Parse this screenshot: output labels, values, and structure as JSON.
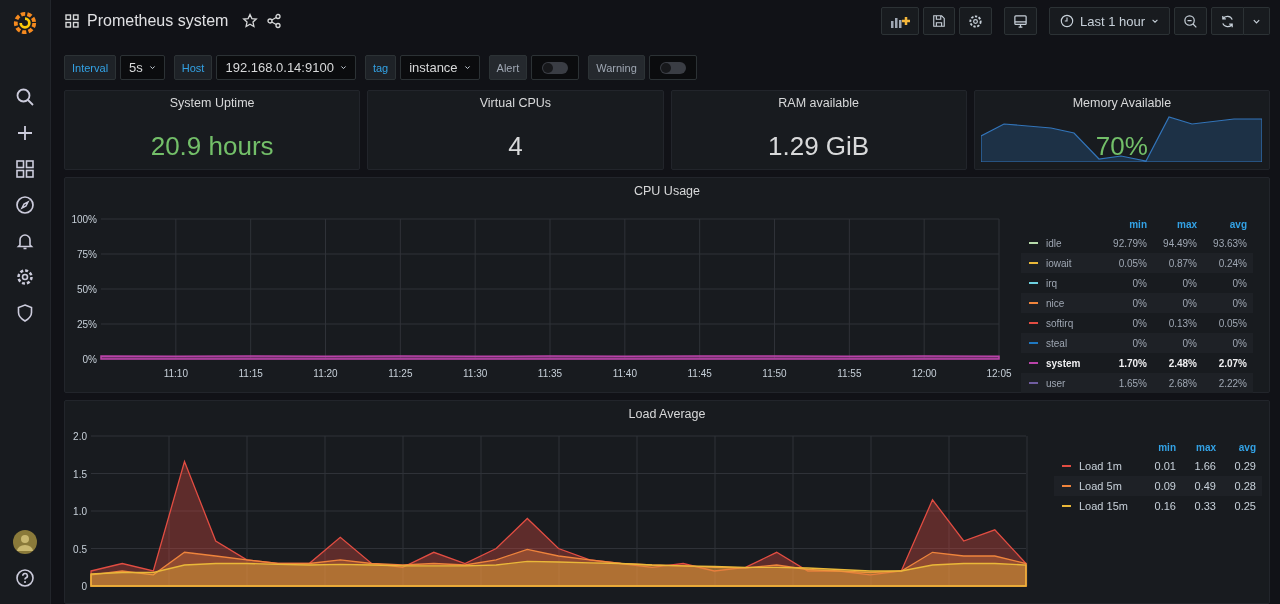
{
  "dashboard": {
    "title": "Prometheus system",
    "starred": false
  },
  "toolbar": {
    "time_range": "Last 1 hour"
  },
  "variables": [
    {
      "kind": "select",
      "label": "Interval",
      "value": "5s"
    },
    {
      "kind": "select",
      "label": "Host",
      "value": "192.168.0.14:9100"
    },
    {
      "kind": "select",
      "label": "tag",
      "value": "instance"
    },
    {
      "kind": "toggle",
      "label": "Alert",
      "on": false
    },
    {
      "kind": "toggle",
      "label": "Warning",
      "on": false
    }
  ],
  "stats": [
    {
      "title": "System Uptime",
      "value": "20.9 hours",
      "color": "#73bf69",
      "sparkline": false
    },
    {
      "title": "Virtual CPUs",
      "value": "4",
      "color": "#d8d9da",
      "sparkline": false
    },
    {
      "title": "RAM available",
      "value": "1.29 GiB",
      "color": "#d8d9da",
      "sparkline": false
    },
    {
      "title": "Memory Available",
      "value": "70%",
      "color": "#73bf69",
      "sparkline": true
    }
  ],
  "cpu_panel": {
    "title": "CPU Usage",
    "legend": {
      "columns": [
        "min",
        "max",
        "avg"
      ],
      "rows": [
        {
          "kind": "unplotted",
          "name": "idle",
          "color": "#b7dbab",
          "highlighted": false,
          "values": [
            "92.79%",
            "94.49%",
            "93.63%"
          ]
        },
        {
          "kind": "unplotted",
          "name": "iowait",
          "color": "#eab839",
          "highlighted": false,
          "values": [
            "0.05%",
            "0.87%",
            "0.24%"
          ]
        },
        {
          "kind": "unplotted",
          "name": "irq",
          "color": "#6ed0e0",
          "highlighted": false,
          "values": [
            "0%",
            "0%",
            "0%"
          ]
        },
        {
          "kind": "unplotted",
          "name": "nice",
          "color": "#ef843c",
          "highlighted": false,
          "values": [
            "0%",
            "0%",
            "0%"
          ]
        },
        {
          "kind": "unplotted",
          "name": "softirq",
          "color": "#e24d42",
          "highlighted": false,
          "values": [
            "0%",
            "0.13%",
            "0.05%"
          ]
        },
        {
          "kind": "unplotted",
          "name": "steal",
          "color": "#1f78c1",
          "highlighted": false,
          "values": [
            "0%",
            "0%",
            "0%"
          ]
        },
        {
          "kind": "plotted",
          "highlighted": true,
          "values": [
            "1.70%",
            "2.48%",
            "2.07%"
          ]
        },
        {
          "kind": "unplotted",
          "name": "user",
          "color": "#705da0",
          "highlighted": false,
          "values": [
            "1.65%",
            "2.68%",
            "2.22%"
          ]
        }
      ]
    },
    "chart_data": {
      "type": "area",
      "grid": true,
      "legend": "right",
      "categories": [
        null,
        "11:10",
        "11:15",
        "11:20",
        "11:25",
        "11:30",
        "11:35",
        "11:40",
        "11:45",
        "11:50",
        "11:55",
        "12:00",
        "12:05"
      ],
      "ylim": [
        0,
        100
      ],
      "yticks": [
        {
          "value": 0,
          "label": "0%"
        },
        {
          "value": 25,
          "label": "25%"
        },
        {
          "value": 50,
          "label": "50%"
        },
        {
          "value": 75,
          "label": "75%"
        },
        {
          "value": 100,
          "label": "100%"
        }
      ],
      "series": [
        {
          "name": "system",
          "color": "#ba43a9",
          "values": [
            2.1,
            2.0,
            2.2,
            2.0,
            2.1,
            2.0,
            2.1,
            2.0,
            2.1,
            2.2,
            2.0,
            2.1,
            2.0
          ]
        }
      ]
    }
  },
  "load_panel": {
    "title": "Load Average",
    "legend": {
      "columns": [
        "min",
        "max",
        "avg"
      ],
      "rows": [
        {
          "kind": "plotted",
          "highlighted": false,
          "values": [
            "0.01",
            "1.66",
            "0.29"
          ]
        },
        {
          "kind": "plotted",
          "highlighted": false,
          "values": [
            "0.09",
            "0.49",
            "0.28"
          ]
        },
        {
          "kind": "plotted",
          "highlighted": false,
          "values": [
            "0.16",
            "0.33",
            "0.25"
          ]
        }
      ]
    },
    "chart_data": {
      "type": "area",
      "grid": true,
      "legend": "right",
      "categories": [
        null,
        null,
        null,
        null,
        null,
        null,
        null,
        null,
        null,
        null,
        null,
        null,
        null,
        null,
        null,
        null,
        null,
        null,
        null,
        null,
        null,
        null,
        null,
        null,
        null,
        null,
        null,
        null,
        null,
        null,
        null
      ],
      "ylim": [
        0,
        2
      ],
      "yticks": [
        {
          "value": 0,
          "label": "0"
        },
        {
          "value": 0.5,
          "label": "0.5"
        },
        {
          "value": 1,
          "label": "1.0"
        },
        {
          "value": 1.5,
          "label": "1.5"
        },
        {
          "value": 2,
          "label": "2.0"
        }
      ],
      "series": [
        {
          "name": "Load 1m",
          "color": "#e24d42",
          "values": [
            0.2,
            0.3,
            0.2,
            1.66,
            0.6,
            0.35,
            0.3,
            0.3,
            0.65,
            0.3,
            0.25,
            0.45,
            0.3,
            0.5,
            0.9,
            0.5,
            0.35,
            0.3,
            0.25,
            0.3,
            0.2,
            0.25,
            0.45,
            0.2,
            0.2,
            0.15,
            0.2,
            1.15,
            0.6,
            0.75,
            0.3
          ]
        },
        {
          "name": "Load 5m",
          "color": "#ef843c",
          "values": [
            0.15,
            0.2,
            0.15,
            0.45,
            0.4,
            0.35,
            0.3,
            0.3,
            0.35,
            0.3,
            0.28,
            0.3,
            0.28,
            0.35,
            0.49,
            0.4,
            0.35,
            0.3,
            0.28,
            0.27,
            0.25,
            0.24,
            0.28,
            0.22,
            0.2,
            0.18,
            0.2,
            0.45,
            0.4,
            0.4,
            0.3
          ]
        },
        {
          "name": "Load 15m",
          "color": "#eab839",
          "values": [
            0.16,
            0.18,
            0.18,
            0.28,
            0.3,
            0.3,
            0.29,
            0.28,
            0.29,
            0.28,
            0.27,
            0.27,
            0.27,
            0.28,
            0.33,
            0.32,
            0.31,
            0.3,
            0.28,
            0.27,
            0.26,
            0.25,
            0.25,
            0.24,
            0.22,
            0.2,
            0.2,
            0.28,
            0.3,
            0.3,
            0.28
          ]
        }
      ]
    }
  }
}
